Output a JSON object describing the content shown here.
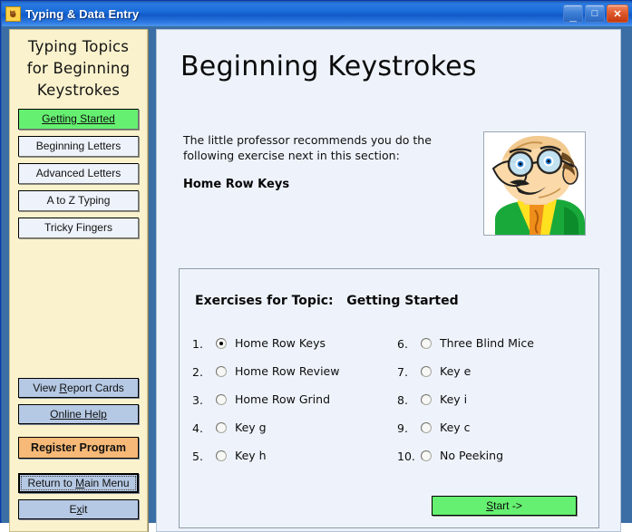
{
  "window": {
    "title": "Typing & Data Entry",
    "icon": "cat-icon",
    "caption_buttons": [
      {
        "name": "minimize-button",
        "glyph": "_"
      },
      {
        "name": "maximize-button",
        "glyph": "□"
      },
      {
        "name": "close-button",
        "glyph": "✕"
      }
    ]
  },
  "sidebar": {
    "title": "Typing Topics for Beginning Keystrokes",
    "title_lines": [
      "Typing Topics",
      "for Beginning",
      "Keystrokes"
    ],
    "topics": [
      {
        "label": "Getting Started",
        "active": true,
        "underline": true
      },
      {
        "label": "Beginning Letters",
        "active": false,
        "underline": false
      },
      {
        "label": "Advanced Letters",
        "active": false,
        "underline": false
      },
      {
        "label": "A to Z Typing",
        "active": false,
        "underline": false
      },
      {
        "label": "Tricky Fingers",
        "active": false,
        "underline": false
      }
    ],
    "actions": {
      "report_cards": {
        "pre": "View ",
        "accel": "R",
        "post": "eport Cards"
      },
      "online_help": {
        "label": "Online Help"
      },
      "register": {
        "label": "Register Program"
      },
      "return_menu": {
        "pre": "Return to ",
        "accel": "M",
        "post": "ain Menu"
      },
      "exit": {
        "pre": "E",
        "accel": "x",
        "post": "it"
      }
    },
    "colors": {
      "panel_bg": "#faf2cc",
      "topic_active": "#66f071",
      "button_bg": "#b6c9e4",
      "register_bg": "#f7b977"
    }
  },
  "main": {
    "heading": "Beginning Keystrokes",
    "recommend_text": "The little professor recommends you do the following exercise next in this section:",
    "recommend_exercise": "Home Row Keys",
    "professor_image_alt": "little-professor-cartoon",
    "exercises": {
      "title": "Exercises for Topic:   Getting Started",
      "topic_name": "Getting Started",
      "left_column": [
        {
          "num": "1.",
          "label": "Home Row Keys",
          "selected": true
        },
        {
          "num": "2.",
          "label": "Home Row Review",
          "selected": false
        },
        {
          "num": "3.",
          "label": "Home Row Grind",
          "selected": false
        },
        {
          "num": "4.",
          "label": "Key g",
          "selected": false
        },
        {
          "num": "5.",
          "label": "Key h",
          "selected": false
        }
      ],
      "right_column": [
        {
          "num": "6.",
          "label": "Three Blind Mice",
          "selected": false
        },
        {
          "num": "7.",
          "label": "Key e",
          "selected": false
        },
        {
          "num": "8.",
          "label": "Key i",
          "selected": false
        },
        {
          "num": "9.",
          "label": "Key c",
          "selected": false
        },
        {
          "num": "10.",
          "label": "No Peeking",
          "selected": false
        }
      ],
      "start_button": {
        "accel": "S",
        "post": "tart ->"
      }
    },
    "colors": {
      "panel_bg": "#eef3fb",
      "start_bg": "#66f071",
      "frame_blue": "#3a6ea5"
    }
  }
}
